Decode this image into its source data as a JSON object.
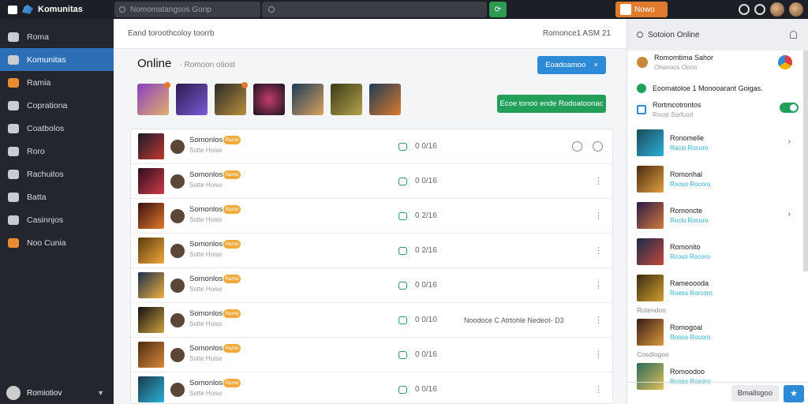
{
  "app": {
    "title": "Komunitas"
  },
  "topbar": {
    "search_placeholder": "Nomomatangsos Gonp",
    "new_label": "Nowo"
  },
  "sidebar": {
    "items": [
      {
        "label": "Roma",
        "icon": "home-icon",
        "active": false
      },
      {
        "label": "Komunitas",
        "icon": "community-icon",
        "active": true
      },
      {
        "label": "Ramia",
        "icon": "star-icon",
        "active": false
      },
      {
        "label": "Coprationa",
        "icon": "briefcase-icon",
        "active": false
      },
      {
        "label": "Coatbolos",
        "icon": "gamepad-icon",
        "active": false
      },
      {
        "label": "Roro",
        "icon": "controller-icon",
        "active": false
      },
      {
        "label": "Rachuitos",
        "icon": "search-icon",
        "active": false
      },
      {
        "label": "Batta",
        "icon": "tag-icon",
        "active": false
      },
      {
        "label": "Casinnjos",
        "icon": "dice-icon",
        "active": false
      },
      {
        "label": "Noo Cunia",
        "icon": "flame-icon",
        "active": false
      }
    ],
    "user": {
      "name": "Romiotiov"
    }
  },
  "main": {
    "header_left": "Eand toroothcoloy toorrb",
    "header_right": "Romonce1 ASM 21",
    "online_title": "Online",
    "online_sub": "· Romoon otiost",
    "blue_button": "Eoadoamoo",
    "blue_button_close": "×",
    "green_button": "Ecoe tonoo ende Rodoatoonac",
    "rows": [
      {
        "name": "Somonlos",
        "badge": "Ramo",
        "sub": "Sotte Hoiso",
        "stat": "0 0/16",
        "extra": ""
      },
      {
        "name": "Somonlos",
        "badge": "Ramo",
        "sub": "Sotte Hoiso",
        "stat": "0 0/16",
        "extra": ""
      },
      {
        "name": "Somonlos",
        "badge": "Ramo",
        "sub": "Sotte Hoiso",
        "stat": "0 2/16",
        "extra": ""
      },
      {
        "name": "Somonlos",
        "badge": "Ramo",
        "sub": "Sotte Hoiso",
        "stat": "0 2/16",
        "extra": ""
      },
      {
        "name": "Somonlos",
        "badge": "Ramo",
        "sub": "Sotte Hoiso",
        "stat": "0 0/16",
        "extra": ""
      },
      {
        "name": "Somonlos",
        "badge": "Ramo",
        "sub": "Sotte Hoiso",
        "stat": "0 0/10",
        "extra": "Noodoce C Atrtohle Nedeot- D3"
      },
      {
        "name": "Somonlos",
        "badge": "Ramo",
        "sub": "Sotte Hoiso",
        "stat": "0 0/16",
        "extra": ""
      },
      {
        "name": "Somonlos",
        "badge": "Ramo",
        "sub": "Sotte Hoiso",
        "stat": "0 0/16",
        "extra": ""
      }
    ]
  },
  "right_panel": {
    "title": "Sotoion Online",
    "top_item": {
      "name": "Romomtima Sahor",
      "sub": "Ohanoos Oono"
    },
    "check_text": "Eoomatoloe 1 Monooarant Goigas.",
    "toggle_item": {
      "name": "Rortmcotrontos",
      "sub": "Roost Sorfuod"
    },
    "items": [
      {
        "name": "Ronomelle",
        "sub": "Raclo Rocoro"
      },
      {
        "name": "Romonhal",
        "sub": "Rooso Rocoro"
      },
      {
        "name": "Romoncte",
        "sub": "Roclo Rocoro"
      },
      {
        "name": "Romonito",
        "sub": "Rcoso Rocoro"
      },
      {
        "name": "Rameoooda",
        "sub": "Roeso Rorcoro"
      }
    ],
    "section1": "Rotendoo",
    "item6": {
      "name": "Romogoal",
      "sub": "Rooso Rocoro"
    },
    "section2": "Cosdiogoo",
    "item7": {
      "name": "Romoodoo",
      "sub": "Rooso Rosoro"
    },
    "footer_label": "Bmallsgoo"
  }
}
